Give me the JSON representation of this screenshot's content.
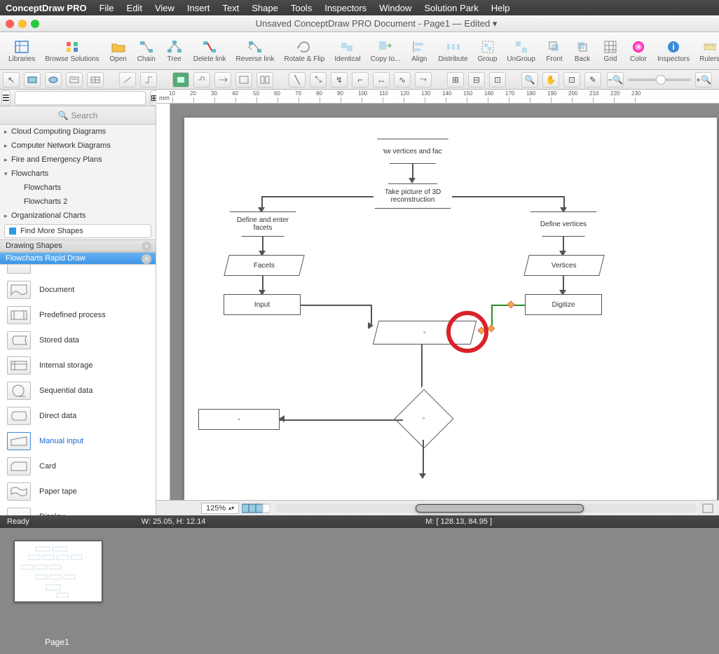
{
  "menubar": {
    "app": "ConceptDraw PRO",
    "items": [
      "File",
      "Edit",
      "View",
      "Insert",
      "Text",
      "Shape",
      "Tools",
      "Inspectors",
      "Window",
      "Solution Park",
      "Help"
    ]
  },
  "titlebar": {
    "title": "Unsaved ConceptDraw PRO Document - Page1 — Edited ▾"
  },
  "toolbar": [
    {
      "id": "libraries",
      "label": "Libraries"
    },
    {
      "id": "browse",
      "label": "Browse Solutions"
    },
    {
      "id": "open",
      "label": "Open"
    },
    {
      "id": "chain",
      "label": "Chain"
    },
    {
      "id": "tree",
      "label": "Tree"
    },
    {
      "id": "deletelink",
      "label": "Delete link"
    },
    {
      "id": "reverse",
      "label": "Reverse link"
    },
    {
      "id": "rotate",
      "label": "Rotate & Flip"
    },
    {
      "id": "identical",
      "label": "Identical"
    },
    {
      "id": "copyto",
      "label": "Copy to..."
    },
    {
      "id": "align",
      "label": "Align"
    },
    {
      "id": "distribute",
      "label": "Distribute"
    },
    {
      "id": "group",
      "label": "Group"
    },
    {
      "id": "ungroup",
      "label": "UnGroup"
    },
    {
      "id": "front",
      "label": "Front"
    },
    {
      "id": "back",
      "label": "Back"
    },
    {
      "id": "grid",
      "label": "Grid"
    },
    {
      "id": "color",
      "label": "Color"
    },
    {
      "id": "inspectors",
      "label": "Inspectors"
    },
    {
      "id": "rulers",
      "label": "Rulers"
    }
  ],
  "tree": [
    {
      "label": "Cloud Computing Diagrams",
      "indent": 0
    },
    {
      "label": "Computer Network Diagrams",
      "indent": 0
    },
    {
      "label": "Fire and Emergency Plans",
      "indent": 0
    },
    {
      "label": "Flowcharts",
      "indent": 0,
      "expanded": true
    },
    {
      "label": "Flowcharts",
      "indent": 1
    },
    {
      "label": "Flowcharts 2",
      "indent": 1
    },
    {
      "label": "Organizational Charts",
      "indent": 0
    }
  ],
  "findmore": "Find More Shapes",
  "libbars": [
    {
      "label": "Drawing Shapes",
      "sel": false
    },
    {
      "label": "Flowcharts Rapid Draw",
      "sel": true
    }
  ],
  "shapes": [
    {
      "label": "Document"
    },
    {
      "label": "Predefined process"
    },
    {
      "label": "Stored data"
    },
    {
      "label": "Internal storage"
    },
    {
      "label": "Sequential data"
    },
    {
      "label": "Direct data"
    },
    {
      "label": "Manual input",
      "sel": true
    },
    {
      "label": "Card"
    },
    {
      "label": "Paper tape"
    },
    {
      "label": "Display"
    }
  ],
  "search": {
    "placeholder": "Search"
  },
  "ruler_unit": "mm",
  "canvas": {
    "nodes": {
      "draw_vertices": "Draw vertices and facets",
      "take_picture": "Take picture of 3D reconstruction",
      "define_enter": "Define and enter facets",
      "define_vertices": "Define vertices",
      "facets": "Facets",
      "vertices": "Vertices",
      "input": "Input",
      "digitize": "Digitize"
    }
  },
  "footer": {
    "zoom": "125%"
  },
  "status": {
    "ready": "Ready",
    "wh": "W: 25.05,  H: 12.14",
    "m": "M: [ 128.13, 84.95 ]"
  },
  "page_thumb": "Page1"
}
